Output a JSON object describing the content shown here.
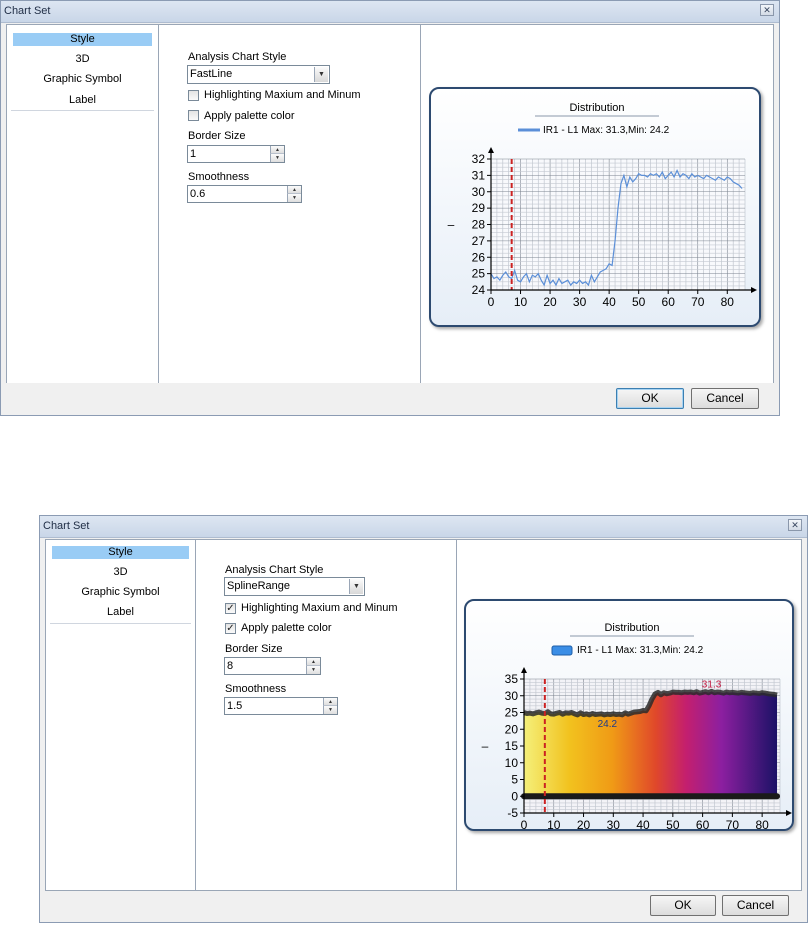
{
  "dialog1": {
    "title": "Chart Set",
    "nav": [
      {
        "label": "Style"
      },
      {
        "label": "3D"
      },
      {
        "label": "Graphic Symbol"
      },
      {
        "label": "Label"
      }
    ],
    "style_label": "Analysis Chart Style",
    "style_value": "FastLine",
    "highlight_label": "Highlighting Maxium and Minum",
    "highlight_checked": false,
    "palette_label": "Apply palette color",
    "palette_checked": false,
    "border_label": "Border Size",
    "border_value": "1",
    "smooth_label": "Smoothness",
    "smooth_value": "0.6",
    "ok": "OK",
    "cancel": "Cancel",
    "chart_title": "Distribution",
    "legend": "IR1 - L1 Max: 31.3,Min: 24.2",
    "ylabel": "–"
  },
  "dialog2": {
    "title": "Chart Set",
    "nav": [
      {
        "label": "Style"
      },
      {
        "label": "3D"
      },
      {
        "label": "Graphic Symbol"
      },
      {
        "label": "Label"
      }
    ],
    "style_label": "Analysis Chart Style",
    "style_value": "SplineRange",
    "highlight_label": "Highlighting Maxium and Minum",
    "highlight_checked": true,
    "palette_label": "Apply palette color",
    "palette_checked": true,
    "border_label": "Border Size",
    "border_value": "8",
    "smooth_label": "Smoothness",
    "smooth_value": "1.5",
    "ok": "OK",
    "cancel": "Cancel",
    "chart_title": "Distribution",
    "legend": "IR1 - L1 Max: 31.3,Min: 24.2",
    "ylabel": "–",
    "max_label": "31.3",
    "min_label": "24.2"
  },
  "colors": {
    "line": "#5b8fd8",
    "marker": "#cc2222",
    "panel_border": "#2d4a70",
    "nav_selected": "#99ccf5"
  },
  "chart_data": [
    {
      "type": "line",
      "title": "Distribution",
      "series": [
        {
          "name": "IR1 - L1 Max: 31.3,Min: 24.2"
        }
      ],
      "x": [
        0,
        1,
        2,
        3,
        4,
        5,
        6,
        7,
        8,
        9,
        10,
        11,
        12,
        13,
        14,
        15,
        16,
        17,
        18,
        19,
        20,
        21,
        22,
        23,
        24,
        25,
        26,
        27,
        28,
        29,
        30,
        31,
        32,
        33,
        34,
        35,
        36,
        37,
        38,
        39,
        40,
        41,
        42,
        43,
        44,
        45,
        46,
        47,
        48,
        49,
        50,
        51,
        52,
        53,
        54,
        55,
        56,
        57,
        58,
        59,
        60,
        61,
        62,
        63,
        64,
        65,
        66,
        67,
        68,
        69,
        70,
        71,
        72,
        73,
        74,
        75,
        76,
        77,
        78,
        79,
        80,
        81,
        82,
        83,
        84,
        85
      ],
      "y": [
        25.0,
        24.7,
        24.8,
        24.6,
        24.9,
        25.1,
        24.8,
        24.7,
        25.2,
        24.6,
        24.5,
        24.8,
        25.0,
        24.5,
        24.9,
        24.8,
        25.0,
        24.6,
        24.3,
        24.9,
        24.4,
        24.6,
        24.3,
        24.7,
        24.4,
        24.5,
        24.6,
        24.3,
        24.5,
        24.4,
        24.6,
        24.4,
        24.5,
        24.3,
        24.9,
        24.5,
        24.8,
        25.1,
        25.2,
        25.3,
        25.6,
        25.5,
        27.0,
        29.0,
        30.5,
        31.0,
        30.3,
        30.9,
        30.6,
        30.8,
        31.1,
        31.0,
        31.0,
        30.9,
        31.1,
        31.0,
        31.1,
        30.9,
        31.2,
        30.8,
        31.0,
        31.2,
        30.9,
        31.3,
        30.9,
        31.1,
        31.0,
        30.8,
        31.1,
        30.9,
        31.0,
        30.9,
        30.8,
        31.0,
        30.9,
        30.8,
        30.7,
        30.9,
        30.8,
        30.7,
        30.9,
        30.8,
        30.6,
        30.5,
        30.4,
        30.2
      ],
      "xlim": [
        0,
        86
      ],
      "ylim": [
        24,
        32
      ],
      "xticks": [
        0,
        10,
        20,
        30,
        40,
        50,
        60,
        70,
        80
      ],
      "yticks": [
        24,
        25,
        26,
        27,
        28,
        29,
        30,
        31,
        32
      ],
      "marker_x": 7,
      "grid": true,
      "legend_position": "top"
    },
    {
      "type": "area",
      "title": "Distribution",
      "series": [
        {
          "name": "IR1 - L1 Max: 31.3,Min: 24.2"
        }
      ],
      "x": [
        0,
        1,
        2,
        3,
        4,
        5,
        6,
        7,
        8,
        9,
        10,
        11,
        12,
        13,
        14,
        15,
        16,
        17,
        18,
        19,
        20,
        21,
        22,
        23,
        24,
        25,
        26,
        27,
        28,
        29,
        30,
        31,
        32,
        33,
        34,
        35,
        36,
        37,
        38,
        39,
        40,
        41,
        42,
        43,
        44,
        45,
        46,
        47,
        48,
        49,
        50,
        51,
        52,
        53,
        54,
        55,
        56,
        57,
        58,
        59,
        60,
        61,
        62,
        63,
        64,
        65,
        66,
        67,
        68,
        69,
        70,
        71,
        72,
        73,
        74,
        75,
        76,
        77,
        78,
        79,
        80,
        81,
        82,
        83,
        84,
        85
      ],
      "y": [
        25.0,
        24.7,
        24.8,
        24.6,
        24.9,
        25.1,
        24.8,
        24.7,
        25.2,
        24.6,
        24.5,
        24.8,
        25.0,
        24.5,
        24.9,
        24.8,
        25.0,
        24.6,
        24.3,
        24.9,
        24.4,
        24.6,
        24.3,
        24.7,
        24.4,
        24.5,
        24.6,
        24.3,
        24.5,
        24.4,
        24.6,
        24.4,
        24.5,
        24.3,
        24.9,
        24.5,
        24.8,
        25.1,
        25.2,
        25.3,
        25.6,
        25.5,
        27.0,
        29.0,
        30.5,
        31.0,
        30.3,
        30.9,
        30.6,
        30.8,
        31.1,
        31.0,
        31.0,
        30.9,
        31.1,
        31.0,
        31.1,
        30.9,
        31.2,
        30.8,
        31.0,
        31.2,
        30.9,
        31.3,
        30.9,
        31.1,
        31.0,
        30.8,
        31.1,
        30.9,
        31.0,
        30.9,
        30.8,
        31.0,
        30.9,
        30.8,
        30.7,
        30.9,
        30.8,
        30.7,
        30.9,
        30.8,
        30.6,
        30.5,
        30.4,
        30.2
      ],
      "baseline": 0,
      "xlim": [
        0,
        86
      ],
      "ylim": [
        -5,
        35
      ],
      "xticks": [
        0,
        10,
        20,
        30,
        40,
        50,
        60,
        70,
        80
      ],
      "yticks": [
        -5,
        0,
        5,
        10,
        15,
        20,
        25,
        30,
        35
      ],
      "marker_x": 7,
      "max_point": [
        63,
        31.3
      ],
      "min_point": [
        28,
        24.2
      ],
      "grid": true,
      "legend_position": "top"
    }
  ]
}
